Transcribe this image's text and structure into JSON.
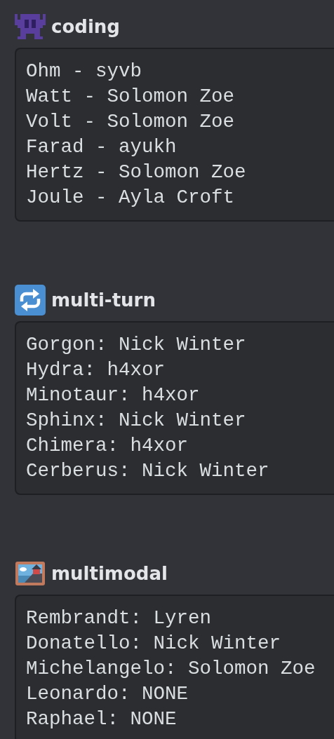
{
  "sections": [
    {
      "kind": "invader",
      "title": "coding",
      "lines": [
        "Ohm - syvb",
        "Watt - Solomon Zoe",
        "Volt - Solomon Zoe",
        "Farad - ayukh",
        "Hertz - Solomon Zoe",
        "Joule - Ayla Croft"
      ]
    },
    {
      "kind": "repeat",
      "title": "multi-turn",
      "lines": [
        "Gorgon: Nick Winter",
        "Hydra: h4xor",
        "Minotaur: h4xor",
        "Sphinx: Nick Winter",
        "Chimera: h4xor",
        "Cerberus: Nick Winter"
      ]
    },
    {
      "kind": "picture",
      "title": "multimodal",
      "lines": [
        "Rembrandt: Lyren",
        "Donatello: Nick Winter",
        "Michelangelo: Solomon Zoe",
        "Leonardo: NONE",
        "Raphael: NONE"
      ]
    }
  ]
}
